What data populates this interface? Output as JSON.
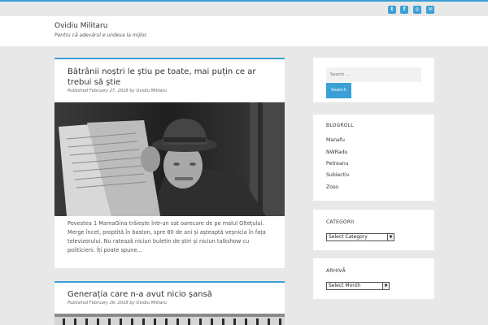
{
  "site": {
    "title": "Ovidiu Militaru",
    "description": "Pentru că adevărul e undeva la mijloc"
  },
  "social": [
    {
      "icon": "twitter-icon",
      "glyph": "t"
    },
    {
      "icon": "facebook-icon",
      "glyph": "f"
    },
    {
      "icon": "instagram-icon",
      "glyph": "◎"
    },
    {
      "icon": "email-icon",
      "glyph": "✉"
    }
  ],
  "posts": [
    {
      "title": "Bătrânii noștri le știu pe toate, mai puțin ce ar trebui să știe",
      "meta": "Published February 27, 2018 by Ovidiu Militaru",
      "excerpt": "Povestea 1 MamaGina trăiește într-un sat oarecare de pe malul Olteţului. Merge încet, proptită în baston, spre 80 de ani și așteaptă veșnicia în fața televizorului. Nu ratează niciun buletin de știri și niciun talkshow cu politicieni. Îți poate spune…"
    },
    {
      "title": "Generația care n-a avut nicio șansă",
      "meta": "Published February 26, 2018 by Ovidiu Militaru"
    }
  ],
  "sidebar": {
    "search": {
      "placeholder": "Search ...",
      "button": "Search"
    },
    "blogroll": {
      "title": "BLOGROLL",
      "links": [
        "Manafu",
        "NWRadu",
        "Petreanu",
        "Subiectiv",
        "Zoso"
      ]
    },
    "categories": {
      "title": "CATEGORII",
      "selected": "Select Category"
    },
    "archive": {
      "title": "ARHIVĂ",
      "selected": "Select Month"
    }
  },
  "colors": {
    "accent": "#3aa0d5",
    "background": "#e8e8e8"
  }
}
